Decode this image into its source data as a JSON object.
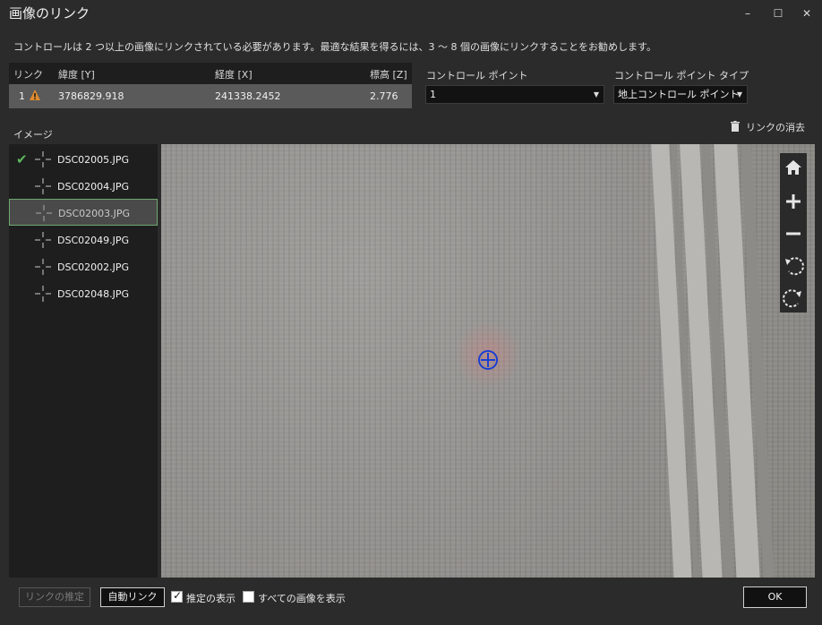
{
  "window": {
    "title": "画像のリンク",
    "minimize": "–",
    "maximize": "☐",
    "close": "✕"
  },
  "notice": "コントロールは 2 つ以上の画像にリンクされている必要があります。最適な結果を得るには、3 ～ 8 個の画像にリンクすることをお勧めします。",
  "link_table": {
    "headers": [
      "リンク",
      "緯度 [Y]",
      "経度 [X]",
      "標高 [Z]"
    ],
    "rows": [
      {
        "link": "1",
        "status_icon": "warning-icon",
        "lat": "3786829.918",
        "lon": "241338.2452",
        "elev": "2.776"
      }
    ]
  },
  "control_point": {
    "label": "コントロール ポイント",
    "value": "1"
  },
  "control_point_type": {
    "label": "コントロール ポイント タイプ",
    "value": "地上コントロール ポイント"
  },
  "clear_link": "リンクの消去",
  "images": {
    "label": "イメージ",
    "items": [
      {
        "name": "DSC02005.JPG",
        "linked": true
      },
      {
        "name": "DSC02004.JPG",
        "linked": false
      },
      {
        "name": "DSC02003.JPG",
        "linked": false,
        "selected": true
      },
      {
        "name": "DSC02049.JPG",
        "linked": false
      },
      {
        "name": "DSC02002.JPG",
        "linked": false
      },
      {
        "name": "DSC02048.JPG",
        "linked": false
      }
    ]
  },
  "viewer_tools": [
    "home-icon",
    "zoom-in-icon",
    "zoom-out-icon",
    "rotate-left-icon",
    "rotate-right-icon"
  ],
  "footer": {
    "estimate_link": "リンクの推定",
    "auto_link": "自動リンク",
    "show_estimate": "推定の表示",
    "show_estimate_checked": true,
    "show_all_images": "すべての画像を表示",
    "show_all_images_checked": false,
    "ok": "OK"
  },
  "colors": {
    "accent_green": "#5cb85c",
    "warning": "#e08a2e",
    "marker_blue": "#1a3fd0"
  }
}
